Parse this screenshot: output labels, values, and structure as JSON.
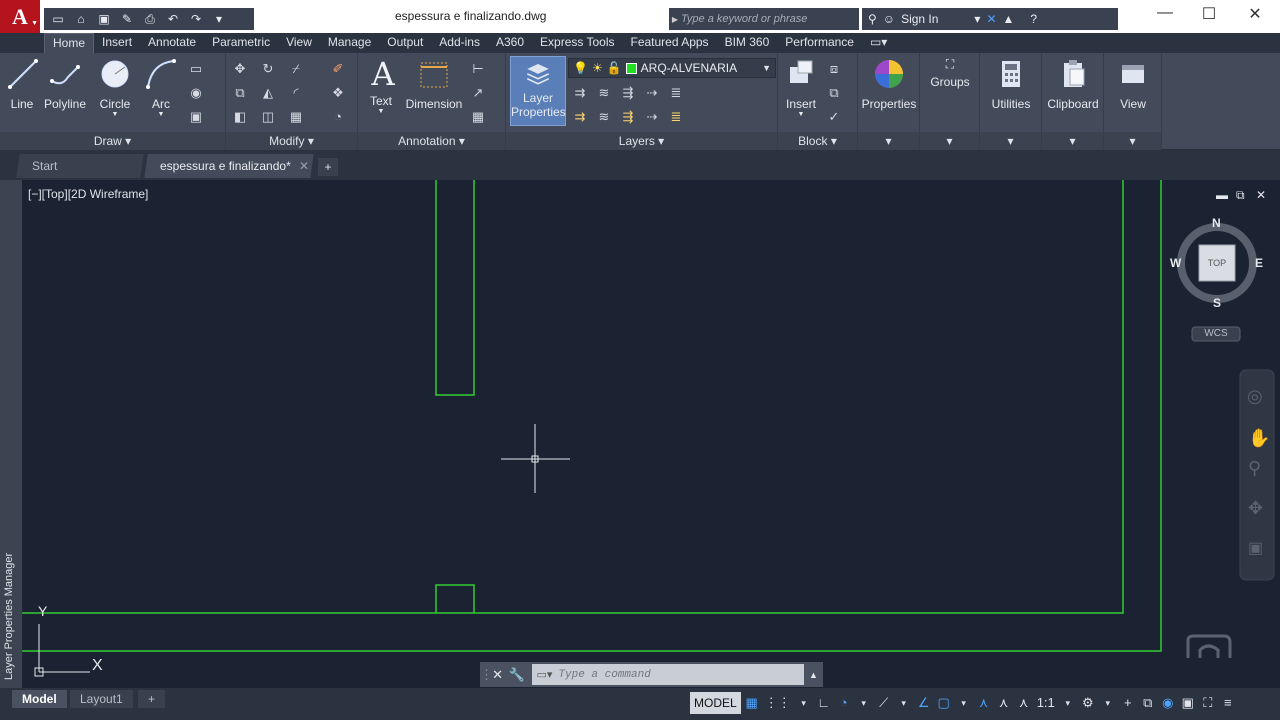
{
  "titlebar": {
    "app_letter": "A",
    "doc_title": "espessura e finalizando.dwg",
    "search_placeholder": "Type a keyword or phrase",
    "signin": "Sign In"
  },
  "ribbon_tabs": [
    "Home",
    "Insert",
    "Annotate",
    "Parametric",
    "View",
    "Manage",
    "Output",
    "Add-ins",
    "A360",
    "Express Tools",
    "Featured Apps",
    "BIM 360",
    "Performance"
  ],
  "ribbon": {
    "draw": {
      "title": "Draw",
      "tools": [
        "Line",
        "Polyline",
        "Circle",
        "Arc"
      ]
    },
    "modify": {
      "title": "Modify"
    },
    "annotation": {
      "title": "Annotation",
      "tools": [
        "Text",
        "Dimension"
      ]
    },
    "layers": {
      "title": "Layers",
      "layer_props_line1": "Layer",
      "layer_props_line2": "Properties",
      "current_layer": "ARQ-ALVENARIA",
      "layer_color": "#22dd22"
    },
    "block": {
      "title": "Block",
      "insert": "Insert"
    },
    "properties": "Properties",
    "groups": "Groups",
    "utilities": "Utilities",
    "clipboard": "Clipboard",
    "view": "View"
  },
  "file_tabs": [
    "Start",
    "espessura e finalizando*"
  ],
  "viewport": {
    "label": "[−][Top][2D Wireframe]",
    "left_palette": "Layer Properties Manager",
    "viewcube": {
      "n": "N",
      "s": "S",
      "e": "E",
      "w": "W",
      "face": "TOP",
      "wcs": "WCS"
    },
    "ucs_x": "X",
    "ucs_y": "Y",
    "geometry_color": "#33cc33"
  },
  "command": {
    "placeholder": "Type a command"
  },
  "layouts": [
    "Model",
    "Layout1"
  ],
  "status": {
    "model": "MODEL",
    "scale": "1:1"
  }
}
